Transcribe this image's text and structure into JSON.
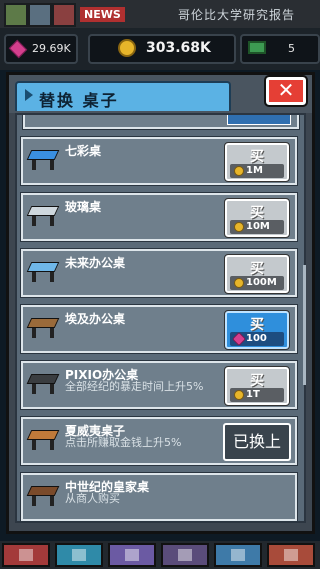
{
  "top_bar": {
    "news_label": "NEWS",
    "news_ticker": "哥伦比大学研究报告"
  },
  "resources": {
    "gems": "29.69K",
    "gold": "303.68K",
    "books": "5"
  },
  "modal": {
    "title": "替换 桌子",
    "close_icon": "close-x-icon"
  },
  "items": [
    {
      "name": "七彩桌",
      "desc": "",
      "action": "买",
      "price": "1M",
      "currency": "coin",
      "desk_color": "#3a8fe0"
    },
    {
      "name": "玻璃桌",
      "desc": "",
      "action": "买",
      "price": "10M",
      "currency": "coin",
      "desk_color": "#cfd8de"
    },
    {
      "name": "未来办公桌",
      "desc": "",
      "action": "买",
      "price": "100M",
      "currency": "coin",
      "desk_color": "#6fb7e8"
    },
    {
      "name": "埃及办公桌",
      "desc": "",
      "action": "买",
      "price": "100",
      "currency": "gem",
      "desk_color": "#9a6a3a"
    },
    {
      "name": "PIXIO办公桌",
      "desc": "全部经纪的暴走时间上升5%",
      "action": "买",
      "price": "1T",
      "currency": "coin",
      "desk_color": "#3a3d40"
    },
    {
      "name": "夏威夷桌子",
      "desc": "点击所赚取金钱上升5%",
      "action": "已换上",
      "price": "",
      "currency": "",
      "desk_color": "#c07a3a"
    },
    {
      "name": "中世纪的皇家桌",
      "desc": "从商人购买",
      "action": "",
      "price": "",
      "currency": "",
      "desk_color": "#7a4a2a"
    }
  ],
  "colors": {
    "accent_blue": "#5bb2e4",
    "close_red": "#e53f35",
    "gem_button": "#2f8fdc"
  }
}
